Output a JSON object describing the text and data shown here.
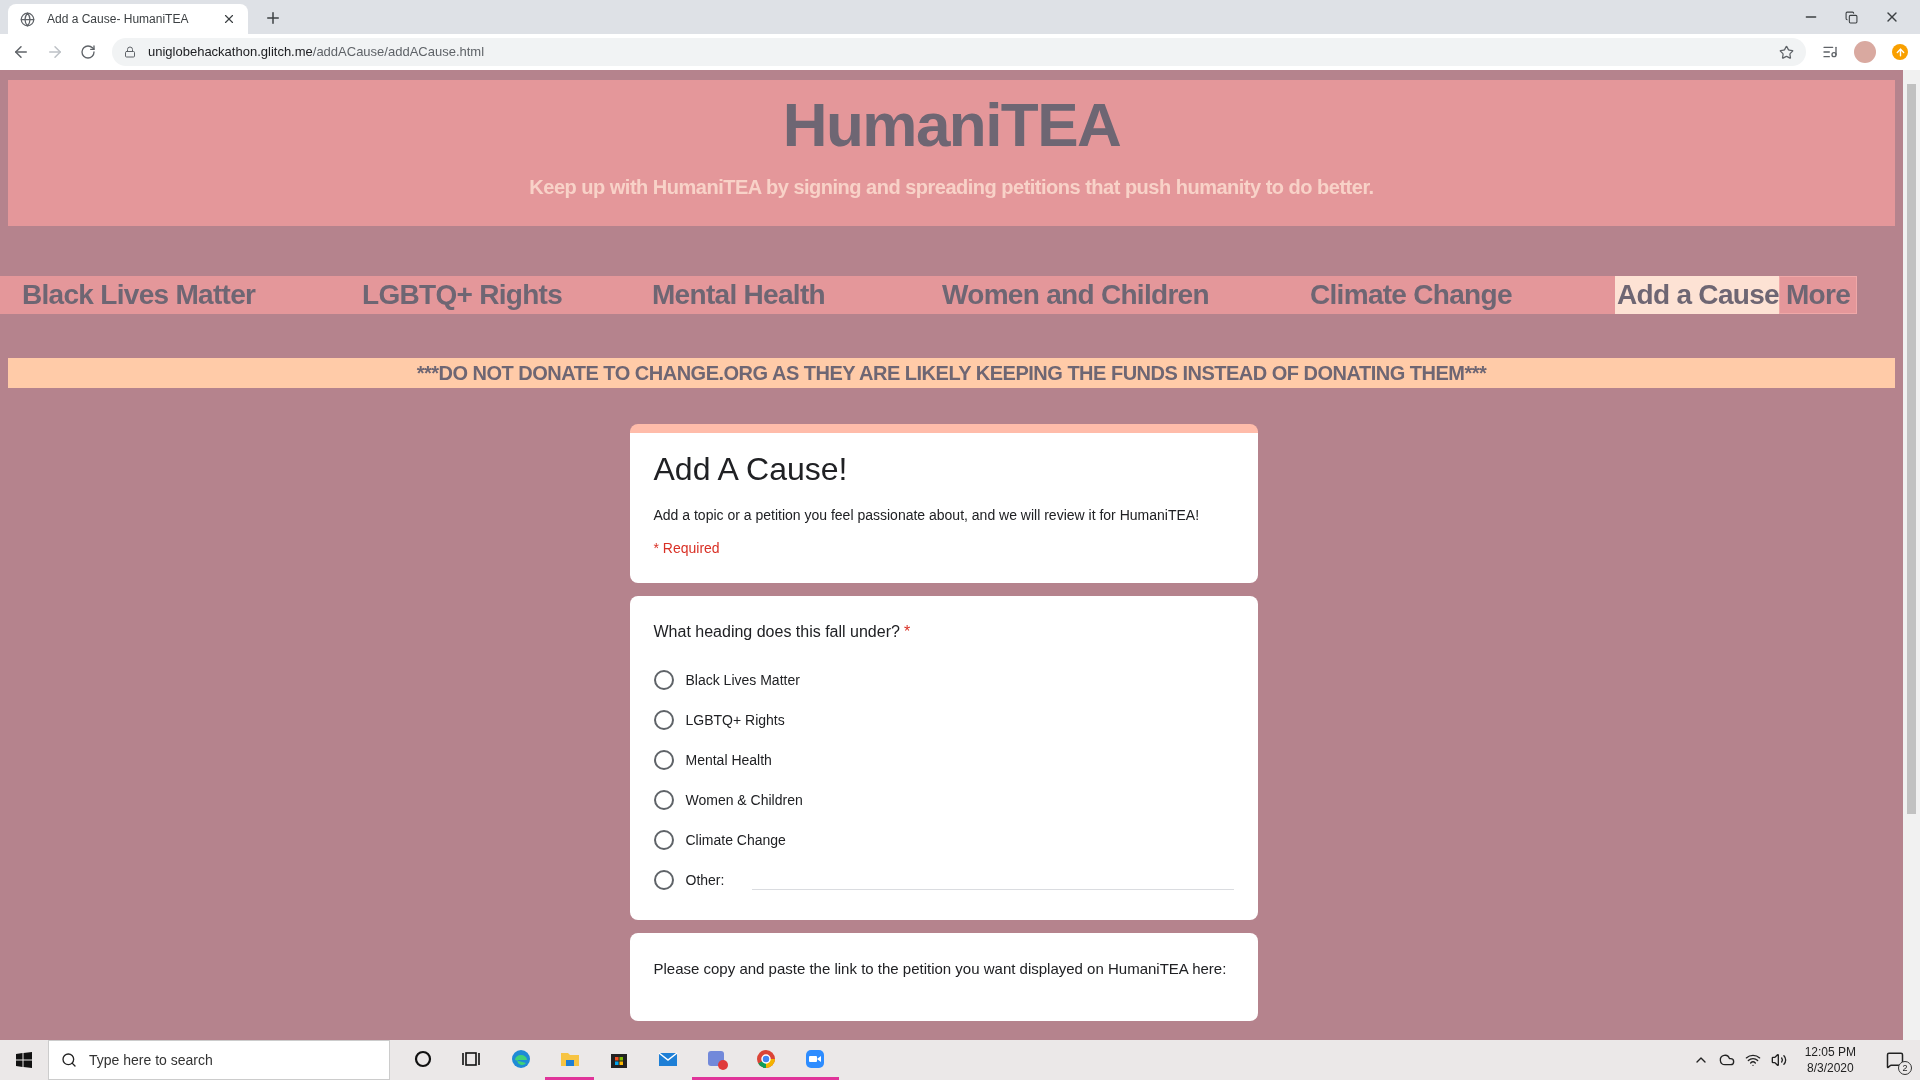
{
  "browser": {
    "tab_title": "Add a Cause- HumaniTEA",
    "url_host": "uniglobehackathon.glitch.me",
    "url_path": "/addACause/addACause.html"
  },
  "header": {
    "title": "HumaniTEA",
    "tagline": "Keep up with HumaniTEA by signing and spreading petitions that push humanity to do better."
  },
  "nav": [
    {
      "label": "Black Lives Matter",
      "selected": false
    },
    {
      "label": "LGBTQ+ Rights",
      "selected": false
    },
    {
      "label": "Mental Health",
      "selected": false
    },
    {
      "label": "Women and Children",
      "selected": false
    },
    {
      "label": "Climate Change",
      "selected": false
    },
    {
      "label": "Add a Cause",
      "selected": true
    }
  ],
  "nav_more": "More",
  "banner": "***DO NOT DONATE TO CHANGE.ORG AS THEY ARE LIKELY KEEPING THE FUNDS INSTEAD OF DONATING THEM***",
  "form": {
    "title": "Add A Cause!",
    "description": "Add a topic or a petition you feel passionate about, and we will review it for HumaniTEA!",
    "required_note": "* Required",
    "question": {
      "label": "What heading does this fall under?",
      "required_mark": "*"
    },
    "options": [
      {
        "kind": "choice",
        "label": "Black Lives Matter",
        "selected": false
      },
      {
        "kind": "choice",
        "label": "LGBTQ+ Rights",
        "selected": false
      },
      {
        "kind": "choice",
        "label": "Mental Health",
        "selected": false
      },
      {
        "kind": "choice",
        "label": "Women & Children",
        "selected": false
      },
      {
        "kind": "choice",
        "label": "Climate Change",
        "selected": false
      },
      {
        "kind": "other",
        "label": "Other:",
        "selected": false
      }
    ],
    "question2": "Please copy and paste the link to the petition you want displayed on HumaniTEA here:"
  },
  "taskbar": {
    "search_placeholder": "Type here to search",
    "time": "12:05 PM",
    "date": "8/3/2020",
    "notifications": "2"
  }
}
